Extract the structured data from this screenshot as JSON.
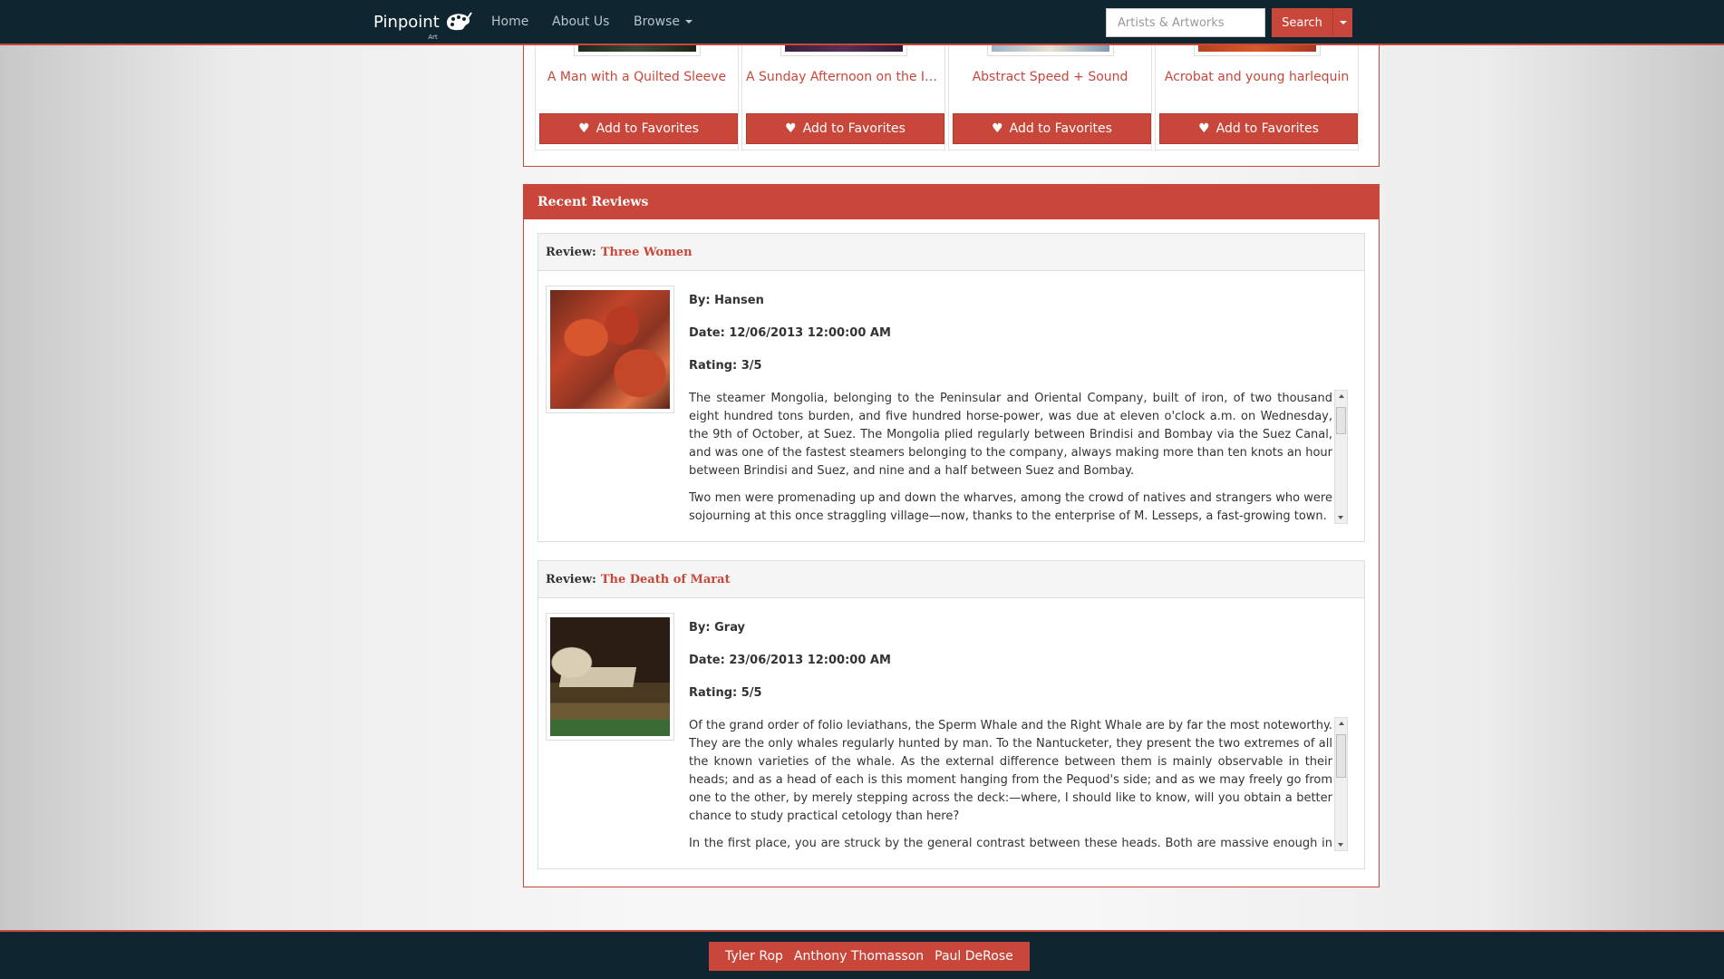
{
  "navbar": {
    "brand": "Pinpoint",
    "brand_sub": "Art",
    "links": [
      "Home",
      "About Us",
      "Browse"
    ],
    "search_placeholder": "Artists & Artworks",
    "search_label": "Search"
  },
  "artworks": [
    {
      "title": "A Man with a Quilted Sleeve",
      "button": "Add to Favorites"
    },
    {
      "title": "A Sunday Afternoon on the Isla…",
      "button": "Add to Favorites"
    },
    {
      "title": "Abstract Speed + Sound",
      "button": "Add to Favorites"
    },
    {
      "title": "Acrobat and young harlequin",
      "button": "Add to Favorites"
    }
  ],
  "reviews_section": {
    "title": "Recent Reviews",
    "reviews": [
      {
        "label": "Review:",
        "artwork": "Three Women",
        "by": "By: Hansen",
        "date": "Date: 12/06/2013 12:00:00 AM",
        "rating": "Rating: 3/5",
        "paragraphs": [
          "The steamer Mongolia, belonging to the Peninsular and Oriental Company, built of iron, of two thousand eight hundred tons burden, and five hundred horse-power, was due at eleven o'clock a.m. on Wednesday, the 9th of October, at Suez. The Mongolia plied regularly between Brindisi and Bombay via the Suez Canal, and was one of the fastest steamers belonging to the company, always making more than ten knots an hour between Brindisi and Suez, and nine and a half between Suez and Bombay.",
          "Two men were promenading up and down the wharves, among the crowd of natives and strangers who were sojourning at this once straggling village—now, thanks to the enterprise of M. Lesseps, a fast-growing town."
        ]
      },
      {
        "label": "Review:",
        "artwork": "The Death of Marat",
        "by": "By: Gray",
        "date": "Date: 23/06/2013 12:00:00 AM",
        "rating": "Rating: 5/5",
        "paragraphs": [
          "Of the grand order of folio leviathans, the Sperm Whale and the Right Whale are by far the most noteworthy. They are the only whales regularly hunted by man. To the Nantucketer, they present the two extremes of all the known varieties of the whale. As the external difference between them is mainly observable in their heads; and as a head of each is this moment hanging from the Pequod's side; and as we may freely go from one to the other, by merely stepping across the deck:—where, I should like to know, will you obtain a better chance to study practical cetology than here?",
          "In the first place, you are struck by the general contrast between these heads. Both are massive enough in all"
        ]
      }
    ]
  },
  "footer": {
    "names": [
      "Tyler Rop",
      "Anthony Thomasson",
      "Paul DeRose"
    ]
  },
  "colors": {
    "accent": "#c9473a",
    "navbar": "#0f2530"
  }
}
